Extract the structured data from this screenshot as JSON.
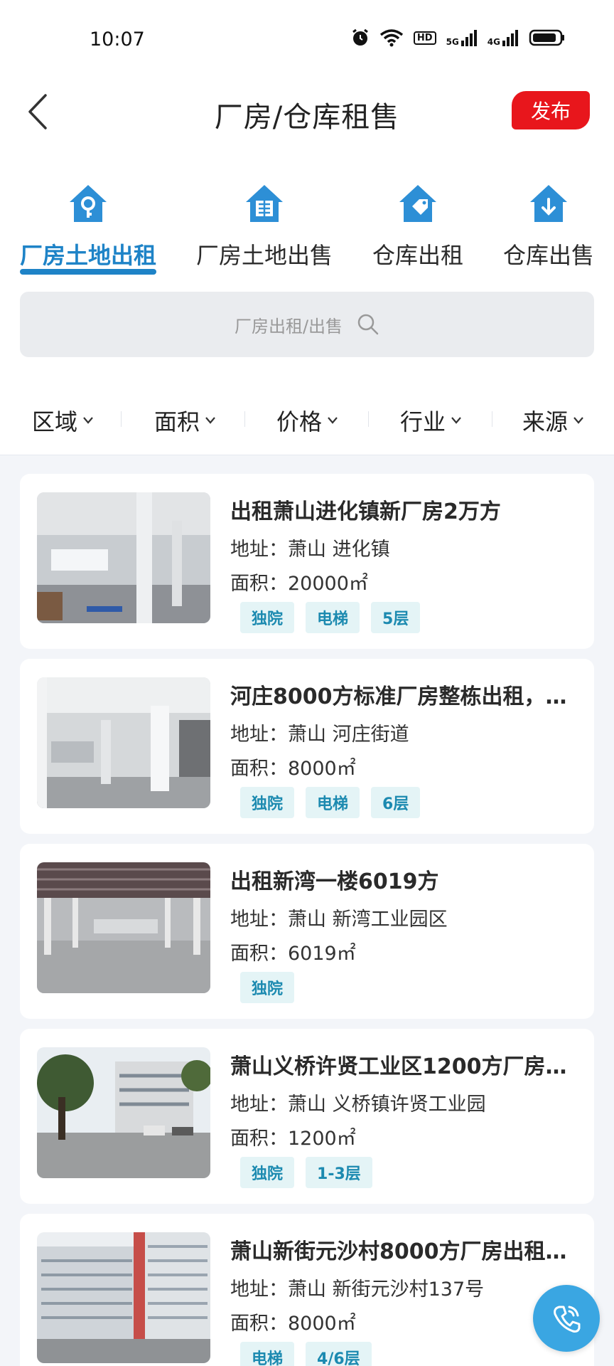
{
  "status_bar": {
    "time": "10:07",
    "net_hd": "HD",
    "net_5g": "5G",
    "net_4g": "4G"
  },
  "header": {
    "title": "厂房/仓库租售",
    "publish_label": "发布"
  },
  "categories": [
    {
      "label": "厂房土地出租",
      "icon": "house-key-icon",
      "active": true
    },
    {
      "label": "厂房土地出售",
      "icon": "house-sale-icon",
      "active": false
    },
    {
      "label": "仓库出租",
      "icon": "house-tag-icon",
      "active": false
    },
    {
      "label": "仓库出售",
      "icon": "house-download-icon",
      "active": false
    }
  ],
  "search": {
    "placeholder": "厂房出租/出售"
  },
  "filters": [
    "区域",
    "面积",
    "价格",
    "行业",
    "来源"
  ],
  "listings": [
    {
      "title": "出租萧山进化镇新厂房2万方",
      "address": "地址：萧山 进化镇",
      "area": "面积：20000㎡",
      "tags": [
        "独院",
        "电梯",
        "5层"
      ]
    },
    {
      "title": "河庄8000方标准厂房整栋出租，…",
      "address": "地址：萧山 河庄街道",
      "area": "面积：8000㎡",
      "tags": [
        "独院",
        "电梯",
        "6层"
      ]
    },
    {
      "title": "出租新湾一楼6019方",
      "address": "地址：萧山 新湾工业园区",
      "area": "面积：6019㎡",
      "tags": [
        "独院"
      ]
    },
    {
      "title": "萧山义桥许贤工业区1200方厂房…",
      "address": "地址：萧山 义桥镇许贤工业园",
      "area": "面积：1200㎡",
      "tags": [
        "独院",
        "1-3层"
      ]
    },
    {
      "title": "萧山新街元沙村8000方厂房出租…",
      "address": "地址：萧山 新街元沙村137号",
      "area": "面积：8000㎡",
      "tags": [
        "电梯",
        "4/6层"
      ]
    }
  ],
  "colors": {
    "accent": "#1e83c7",
    "publish": "#e8161c",
    "tag_bg": "#e4f4f6",
    "tag_text": "#1c8ab0",
    "call": "#3aa6e2"
  }
}
